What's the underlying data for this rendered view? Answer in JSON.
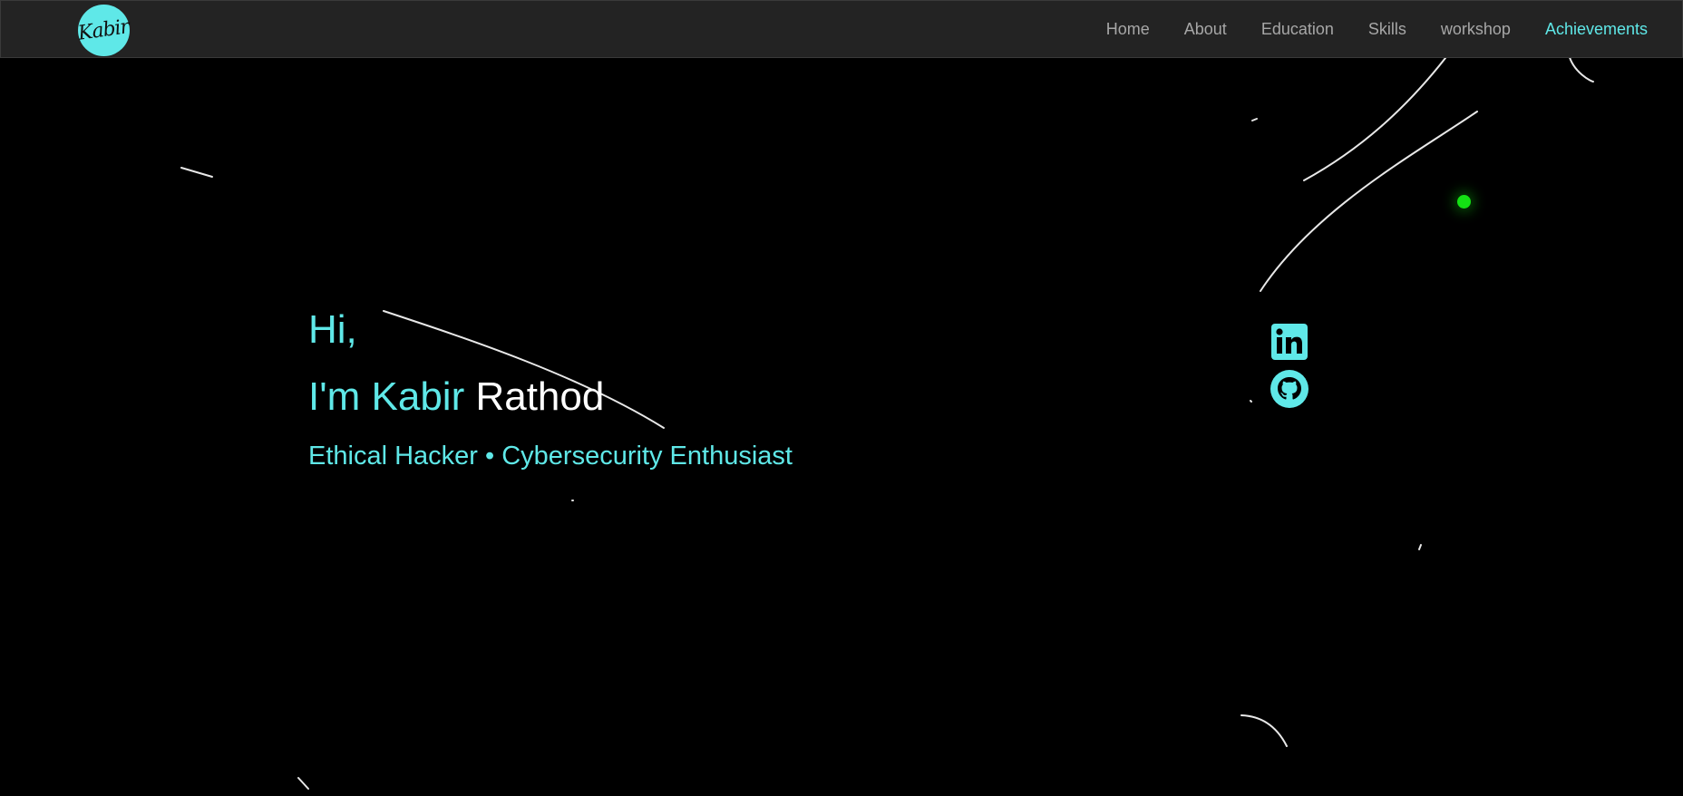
{
  "brand": {
    "logo_text": "Kabir",
    "accent_color": "#5fe8e8"
  },
  "nav": {
    "items": [
      {
        "label": "Home"
      },
      {
        "label": "About"
      },
      {
        "label": "Education"
      },
      {
        "label": "Skills"
      },
      {
        "label": "workshop"
      },
      {
        "label": "Achievements"
      }
    ]
  },
  "hero": {
    "greeting": "Hi,",
    "name_prefix": "I'm Kabir",
    "name_last": "Rathod",
    "tagline": "Ethical Hacker • Cybersecurity Enthusiast"
  },
  "socials": [
    {
      "icon": "linkedin-icon"
    },
    {
      "icon": "github-icon"
    }
  ],
  "decor": {
    "dot_color": "#14e014"
  }
}
